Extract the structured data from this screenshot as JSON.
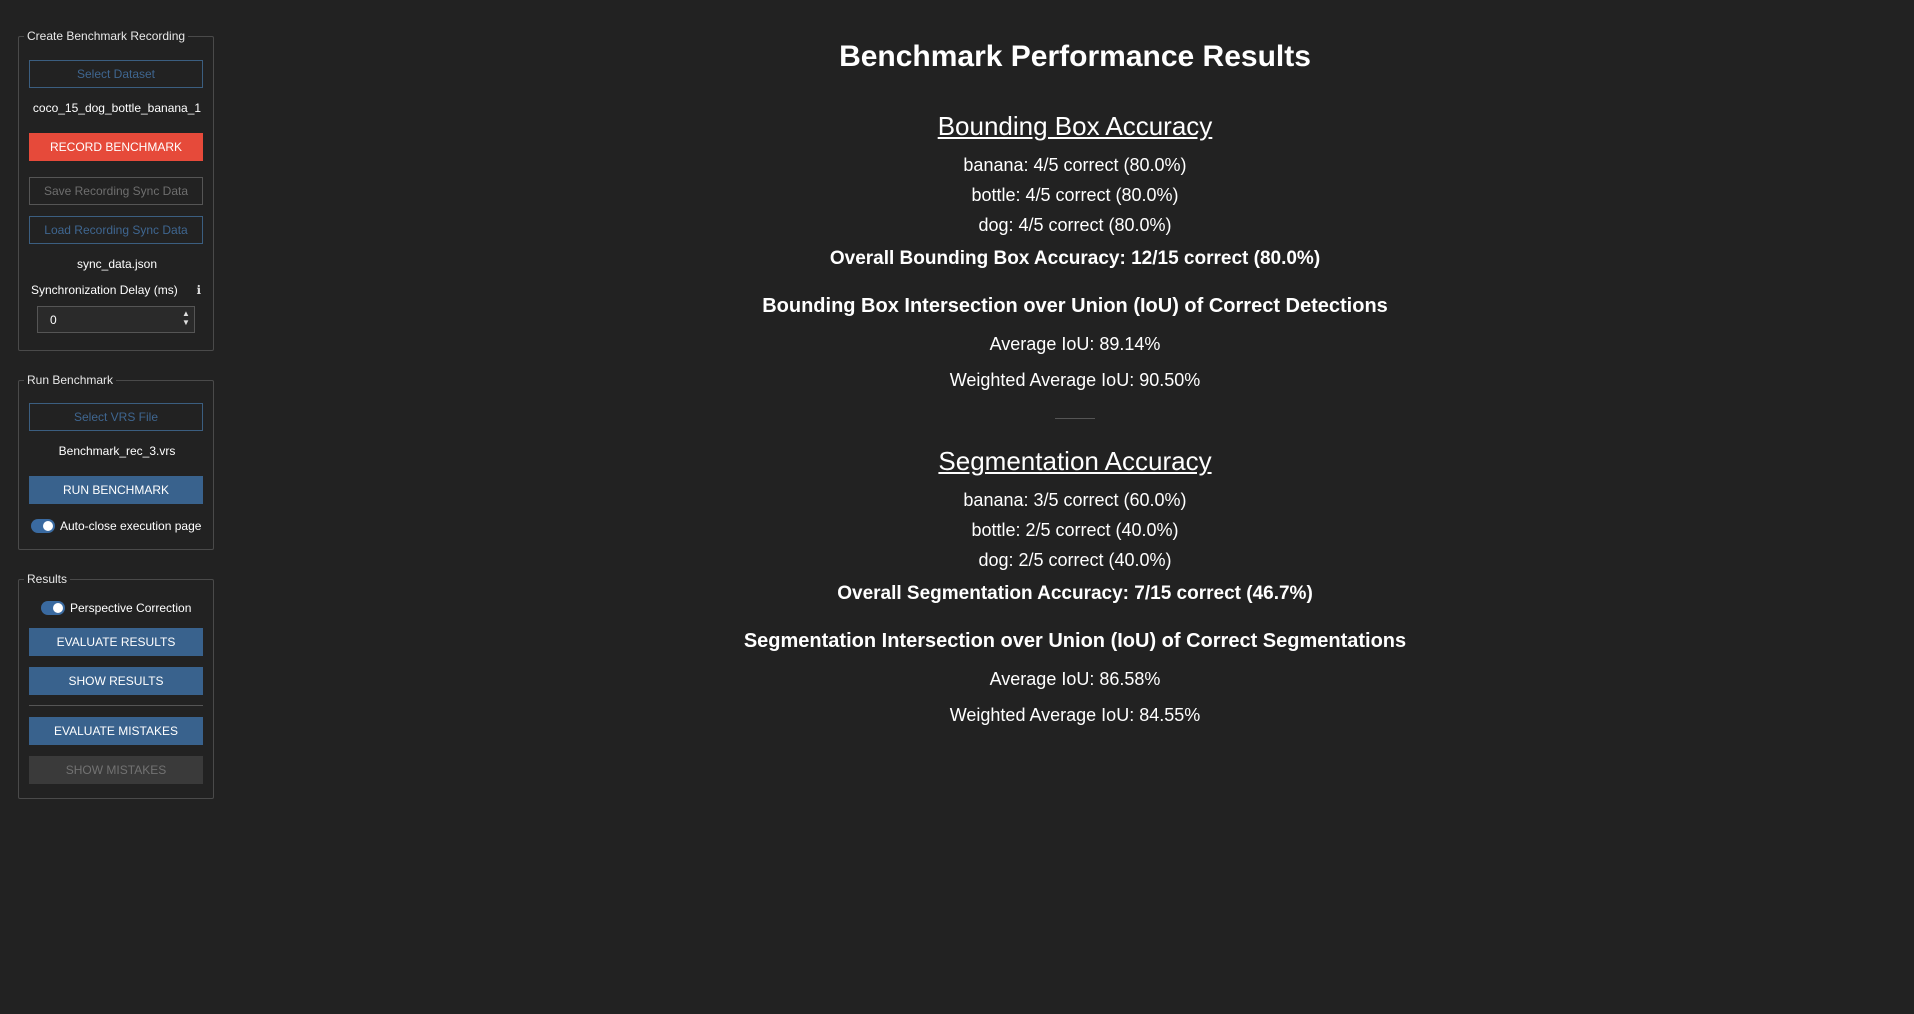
{
  "sidebar": {
    "create_group": {
      "title": "Create Benchmark Recording",
      "select_dataset": "Select Dataset",
      "dataset_name": "coco_15_dog_bottle_banana_1",
      "record": "RECORD BENCHMARK",
      "save_sync": "Save Recording Sync Data",
      "load_sync": "Load Recording Sync Data",
      "sync_file": "sync_data.json",
      "delay_label": "Synchronization Delay (ms)",
      "info_glyph": "ℹ",
      "delay_value": "0"
    },
    "run_group": {
      "title": "Run Benchmark",
      "select_vrs": "Select VRS File",
      "vrs_name": "Benchmark_rec_3.vrs",
      "run": "RUN BENCHMARK",
      "auto_close": "Auto-close execution page"
    },
    "results_group": {
      "title": "Results",
      "perspective": "Perspective Correction",
      "evaluate_results": "EVALUATE RESULTS",
      "show_results": "SHOW RESULTS",
      "evaluate_mistakes": "EVALUATE MISTAKES",
      "show_mistakes": "SHOW MISTAKES"
    }
  },
  "results": {
    "title": "Benchmark Performance Results",
    "bbox": {
      "heading": "Bounding Box Accuracy",
      "rows": [
        "banana: 4/5 correct (80.0%)",
        "bottle: 4/5 correct (80.0%)",
        "dog: 4/5 correct (80.0%)"
      ],
      "overall": "Overall Bounding Box Accuracy: 12/15 correct (80.0%)",
      "iou_heading": "Bounding Box Intersection over Union (IoU) of Correct Detections",
      "avg_iou": "Average IoU: 89.14%",
      "weighted_iou": "Weighted Average IoU: 90.50%"
    },
    "seg": {
      "heading": "Segmentation Accuracy",
      "rows": [
        "banana: 3/5 correct (60.0%)",
        "bottle: 2/5 correct (40.0%)",
        "dog: 2/5 correct (40.0%)"
      ],
      "overall": "Overall Segmentation Accuracy: 7/15 correct (46.7%)",
      "iou_heading": "Segmentation Intersection over Union (IoU) of Correct Segmentations",
      "avg_iou": "Average IoU: 86.58%",
      "weighted_iou": "Weighted Average IoU: 84.55%"
    }
  },
  "colors": {
    "background": "#222222",
    "accent_blue": "#39628d",
    "record_red": "#e64a3a"
  }
}
